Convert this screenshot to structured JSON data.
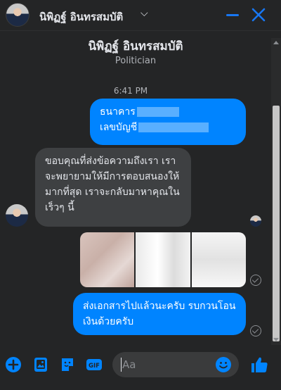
{
  "header": {
    "name": "นิพิฏฐ์ อินทรสมบัติ",
    "chevron": "⌵",
    "minimize_icon": "minimize-icon",
    "close_icon": "close-icon"
  },
  "profile": {
    "name": "นิพิฏฐ์ อินทรสมบัติ",
    "subtitle": "Politician"
  },
  "timestamp": "6:41 PM",
  "messages": {
    "sent_1": {
      "line1": "ธนาคาร",
      "line2": "เลขบัญชี"
    },
    "received_1": "ขอบคุณที่ส่งข้อความถึงเรา เราจะพยายามให้มีการตอบสนองให้มากที่สุด เราจะกลับมาหาคุณในเร็วๆ นี้",
    "sent_2": "ส่งเอกสารไปแล้วนะครับ รบกวนโอนเงินด้วยครับ"
  },
  "composer": {
    "placeholder": "Aa",
    "icons": [
      "plus-icon",
      "photo-icon",
      "sticker-icon",
      "gif-icon",
      "emoji-icon",
      "like-icon"
    ],
    "gif_label": "GIF"
  },
  "colors": {
    "accent": "#0084ff",
    "background": "#242526",
    "incoming_bubble": "#3e4042"
  }
}
